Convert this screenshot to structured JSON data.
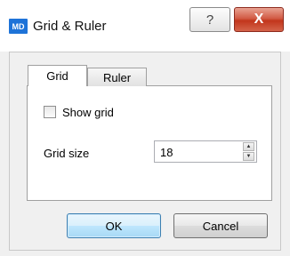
{
  "window": {
    "app_icon_text": "MD",
    "title": "Grid & Ruler",
    "help_glyph": "?",
    "close_glyph": "X"
  },
  "tabs": [
    {
      "label": "Grid",
      "selected": true
    },
    {
      "label": "Ruler",
      "selected": false
    }
  ],
  "grid_tab": {
    "show_grid_label": "Show grid",
    "show_grid_checked": false,
    "grid_size_label": "Grid size",
    "grid_size_value": "18"
  },
  "buttons": {
    "ok": "OK",
    "cancel": "Cancel"
  }
}
